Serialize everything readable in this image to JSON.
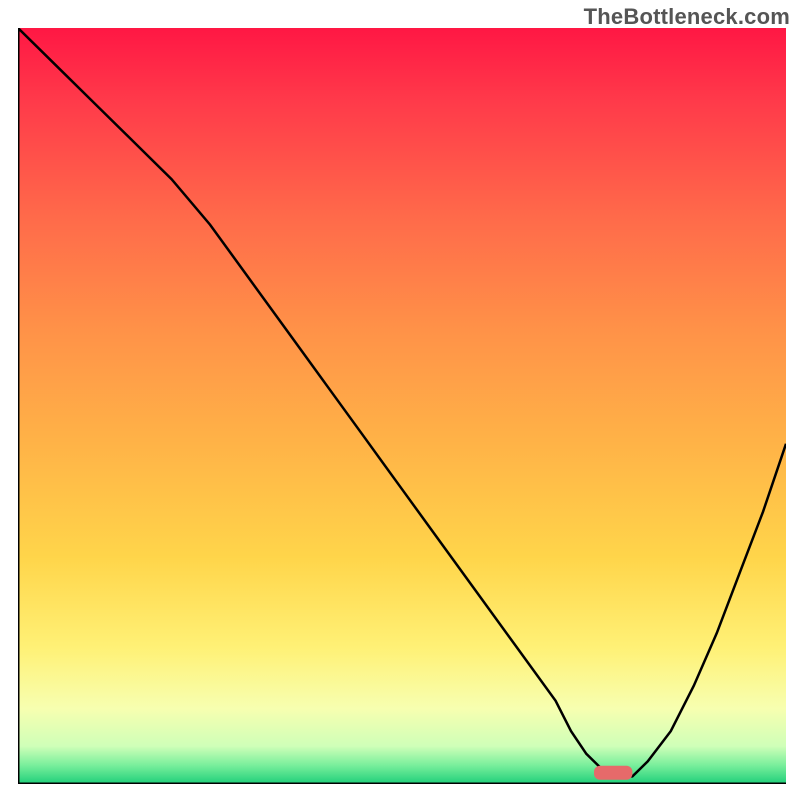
{
  "watermark": "TheBottleneck.com",
  "colors": {
    "curve": "#000000",
    "axis": "#000000",
    "marker": "#e66a6a"
  },
  "gradient_stops": [
    {
      "offset": 0.0,
      "color": "#ff1744"
    },
    {
      "offset": 0.1,
      "color": "#ff3b4a"
    },
    {
      "offset": 0.25,
      "color": "#ff6a4a"
    },
    {
      "offset": 0.4,
      "color": "#ff9248"
    },
    {
      "offset": 0.55,
      "color": "#ffb347"
    },
    {
      "offset": 0.7,
      "color": "#ffd54a"
    },
    {
      "offset": 0.82,
      "color": "#fff176"
    },
    {
      "offset": 0.9,
      "color": "#f7ffb0"
    },
    {
      "offset": 0.95,
      "color": "#cfffb8"
    },
    {
      "offset": 0.975,
      "color": "#7aef9c"
    },
    {
      "offset": 1.0,
      "color": "#1fcf7a"
    }
  ],
  "chart_data": {
    "type": "line",
    "title": "",
    "xlabel": "",
    "ylabel": "",
    "xlim": [
      0,
      100
    ],
    "ylim": [
      0,
      100
    ],
    "grid": false,
    "legend": false,
    "x": [
      0,
      5,
      10,
      15,
      20,
      25,
      30,
      35,
      40,
      45,
      50,
      55,
      60,
      65,
      70,
      72,
      74,
      76,
      78,
      80,
      82,
      85,
      88,
      91,
      94,
      97,
      100
    ],
    "values": [
      100,
      95,
      90,
      85,
      80,
      74,
      67,
      60,
      53,
      46,
      39,
      32,
      25,
      18,
      11,
      7,
      4,
      2,
      1,
      1,
      3,
      7,
      13,
      20,
      28,
      36,
      45
    ],
    "marker": {
      "x_start": 75,
      "x_end": 80,
      "y": 1.5
    },
    "annotations": []
  }
}
